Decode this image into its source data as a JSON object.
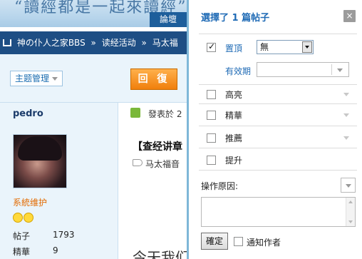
{
  "forum": {
    "banner_text": "“讀經都是一起來讀經”",
    "nav_tab": "論壇",
    "breadcrumb": [
      "神の仆人之家BBS",
      "读经活动",
      "马太福"
    ],
    "topic_manage": "主题管理",
    "reply_button": "回 復",
    "author": {
      "name": "pedro",
      "role": "系統维护",
      "stats": [
        {
          "label": "帖子",
          "value": "1793"
        },
        {
          "label": "精華",
          "value": "9"
        }
      ]
    },
    "posted_label": "發表於 2",
    "post_title": "【查经讲章",
    "post_tag": "马太福音",
    "post_body_snippet": "今天我们"
  },
  "panel": {
    "title": "選擇了 1 篇帖子",
    "close_label": "×",
    "options": {
      "pin": {
        "label": "置頂",
        "checked": true,
        "select_value": "無"
      },
      "expiry_label": "有效期",
      "highlight": {
        "label": "高亮",
        "checked": false
      },
      "digest": {
        "label": "精華",
        "checked": false
      },
      "recommend": {
        "label": "推薦",
        "checked": false
      },
      "bump": {
        "label": "提升",
        "checked": false
      }
    },
    "reason_label": "操作原因:",
    "reason_value": "",
    "confirm_button": "確定",
    "notify_label": "通知作者",
    "notify_checked": false
  },
  "colors": {
    "accent": "#1e6ab5",
    "nav": "#1e4e84",
    "reply": "#f07f0c"
  }
}
